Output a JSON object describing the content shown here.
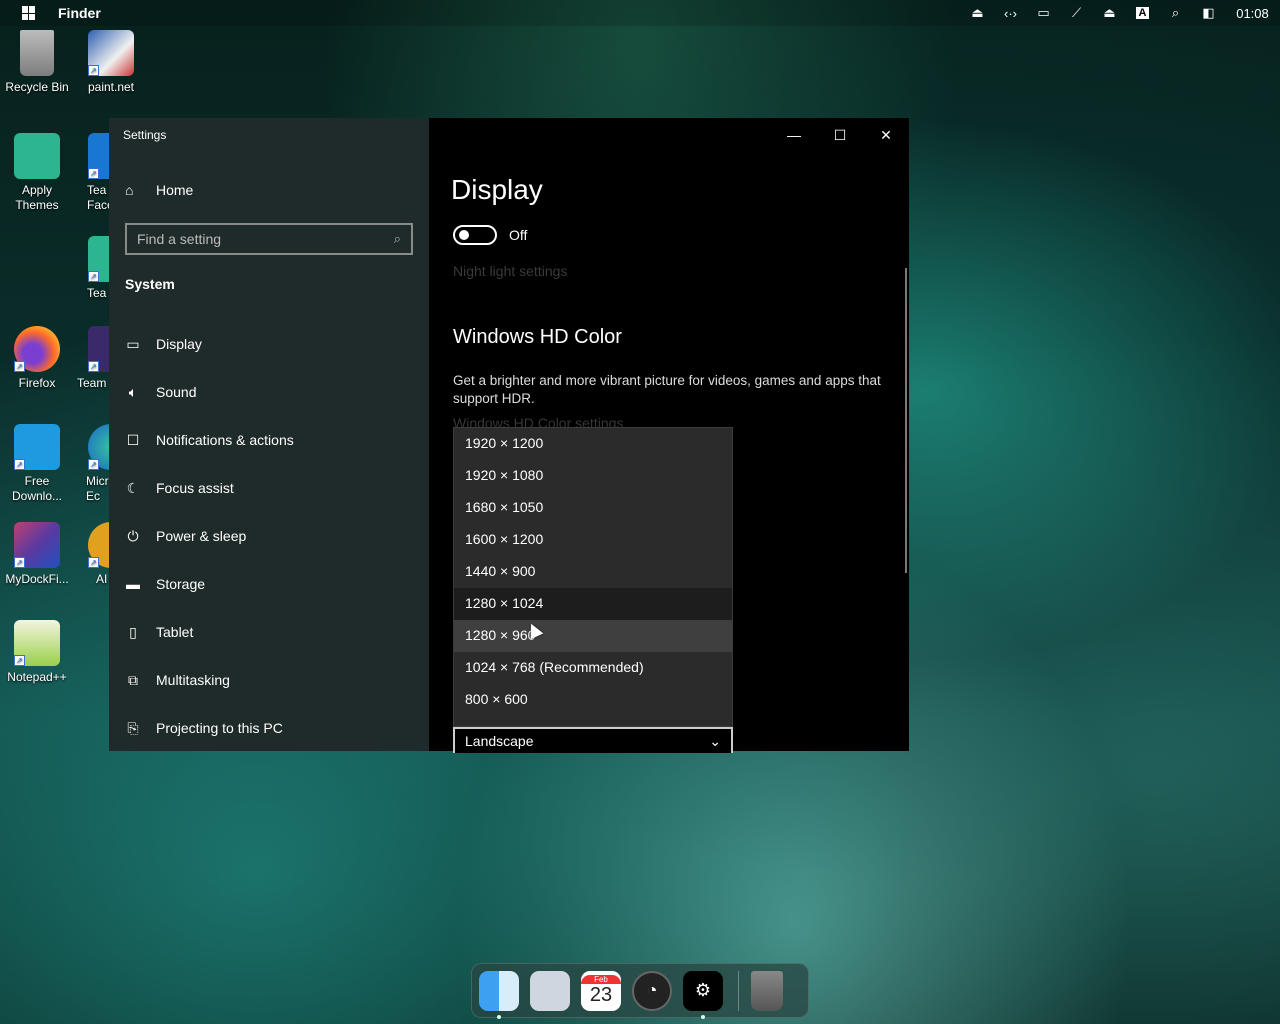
{
  "menubar": {
    "app_name": "Finder",
    "clock": "01:08",
    "input_indicator": "A"
  },
  "desktop_icons": [
    {
      "label": "Recycle Bin",
      "icon": "recycle-bin-icon"
    },
    {
      "label": "paint.net",
      "icon": "paintnet-icon"
    },
    {
      "label": "Apply Themes",
      "icon": "folder-icon"
    },
    {
      "label": "Tea Face",
      "icon": "gear-icon"
    },
    {
      "label": "Tea",
      "icon": "folder-icon"
    },
    {
      "label": "Firefox",
      "icon": "firefox-icon"
    },
    {
      "label": "Team",
      "icon": "app-icon"
    },
    {
      "label": "Free Downlo...",
      "icon": "download-icon"
    },
    {
      "label": "Micr Ec",
      "icon": "edge-icon"
    },
    {
      "label": "MyDockFi...",
      "icon": "mydock-icon"
    },
    {
      "label": "AI",
      "icon": "app-icon"
    },
    {
      "label": "Notepad++",
      "icon": "notepadpp-icon"
    }
  ],
  "settings": {
    "window_title": "Settings",
    "home_label": "Home",
    "search_placeholder": "Find a setting",
    "section_label": "System",
    "nav_items": [
      {
        "label": "Display",
        "icon": "monitor-icon"
      },
      {
        "label": "Sound",
        "icon": "speaker-icon"
      },
      {
        "label": "Notifications & actions",
        "icon": "notification-icon"
      },
      {
        "label": "Focus assist",
        "icon": "moon-icon"
      },
      {
        "label": "Power & sleep",
        "icon": "power-icon"
      },
      {
        "label": "Storage",
        "icon": "storage-icon"
      },
      {
        "label": "Tablet",
        "icon": "tablet-icon"
      },
      {
        "label": "Multitasking",
        "icon": "multitasking-icon"
      },
      {
        "label": "Projecting to this PC",
        "icon": "projecting-icon"
      }
    ],
    "main": {
      "page_title": "Display",
      "night_light_state": "Off",
      "night_light_link": "Night light settings",
      "hdr_title": "Windows HD Color",
      "hdr_description": "Get a brighter and more vibrant picture for videos, games and apps that support HDR.",
      "hdr_link": "Windows HD Color settings",
      "resolution_options": [
        "1920 × 1200",
        "1920 × 1080",
        "1680 × 1050",
        "1600 × 1200",
        "1440 × 900",
        "1280 × 1024",
        "1280 × 960",
        "1024 × 768 (Recommended)",
        "800 × 600"
      ],
      "resolution_selected": "1280 × 1024",
      "resolution_hovered": "1280 × 960",
      "orientation_value": "Landscape"
    }
  },
  "dock": {
    "calendar_month": "Feb",
    "calendar_day": "23"
  },
  "colors": {
    "sidebar_bg": "#1f2b2a",
    "main_bg": "#000000",
    "dropdown_bg": "#2b2b2b"
  }
}
